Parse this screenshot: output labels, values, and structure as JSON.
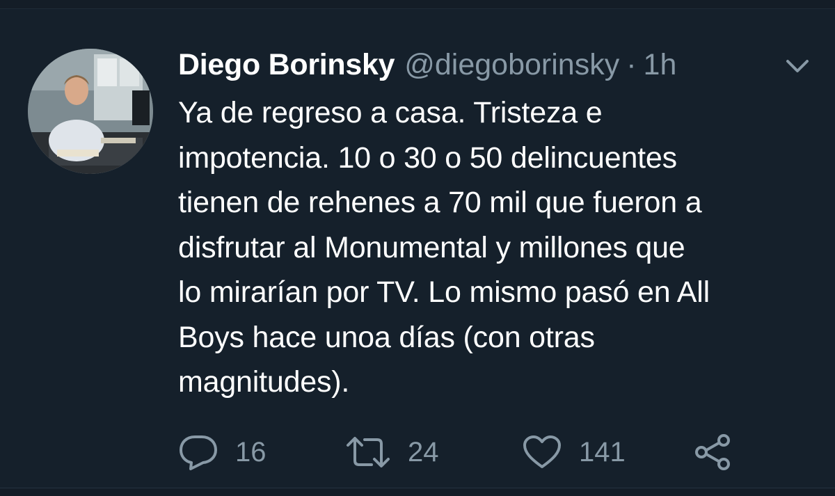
{
  "tweet": {
    "author_name": "Diego Borinsky",
    "author_handle": "@diegoborinsky",
    "separator": "·",
    "timestamp": "1h",
    "text": "Ya de regreso a casa. Tristeza e\nimpotencia. 10 o 30 o 50 delincuentes\ntienen de rehenes a 70 mil que fueron a\ndisfrutar al Monumental y millones que\nlo mirarían por TV. Lo mismo pasó en All\nBoys hace unoa días  (con otras\nmagnitudes).",
    "counts": {
      "replies": "16",
      "retweets": "24",
      "likes": "141"
    }
  },
  "icons": {
    "menu": "chevron-down-icon",
    "reply": "reply-icon",
    "retweet": "retweet-icon",
    "like": "heart-icon",
    "share": "share-icon"
  },
  "colors": {
    "background": "#15202b",
    "text_primary": "#ffffff",
    "text_secondary": "#8899a6"
  }
}
